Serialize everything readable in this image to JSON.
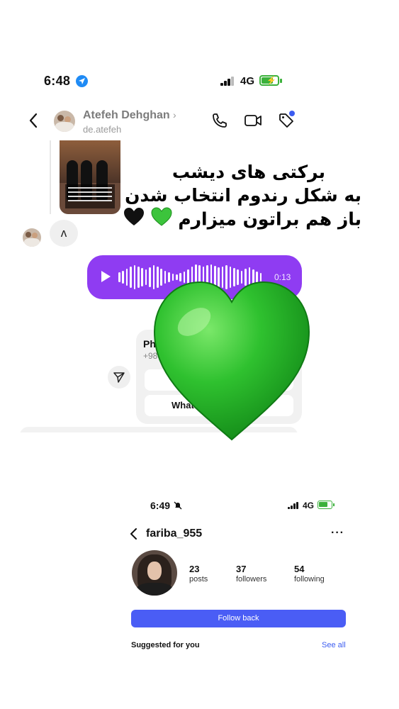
{
  "chat_screenshot": {
    "status_bar": {
      "time": "6:48",
      "network": "4G"
    },
    "header": {
      "name": "Atefeh Dehghan",
      "chevron": "›",
      "handle": "de.atefeh"
    },
    "reaction_text": "ʌ",
    "voice_message": {
      "duration": "0:13",
      "color": "#8f3cf2"
    },
    "contact_card": {
      "title": "Pho",
      "number": "+98",
      "whatsapp_label": "Whats"
    }
  },
  "caption": {
    "line1": "برکتی های دیشب",
    "line2": "به شکل رندوم انتخاب شدن",
    "line3": "باز هم براتون میزارم",
    "line3_emojis": [
      "green-heart",
      "black-heart"
    ]
  },
  "sticker": {
    "name": "green-heart",
    "color": "#2fbf2f"
  },
  "profile_screenshot": {
    "status_bar": {
      "time": "6:49",
      "network": "4G"
    },
    "username": "fariba_955",
    "more": "···",
    "stats": [
      {
        "value": "23",
        "label": "posts"
      },
      {
        "value": "37",
        "label": "followers"
      },
      {
        "value": "54",
        "label": "following"
      }
    ],
    "follow_button": "Follow back",
    "suggested_label": "Suggested for you",
    "see_all": "See all",
    "accent_color": "#4a5df5"
  }
}
